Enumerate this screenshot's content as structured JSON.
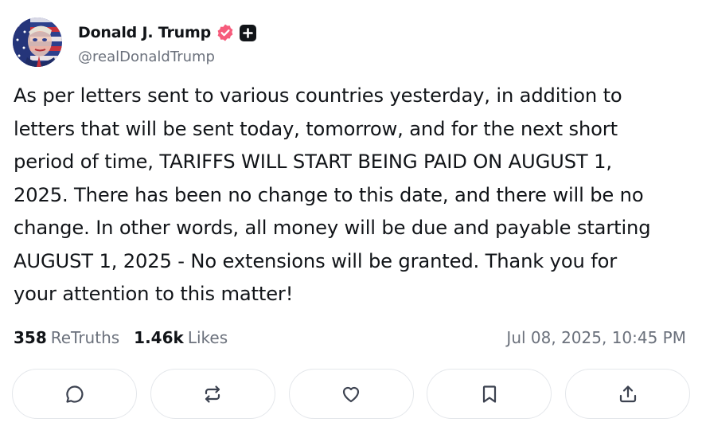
{
  "author": {
    "display_name": "Donald J. Trump",
    "handle": "@realDonaldTrump",
    "avatar_icon": "avatar-flag-portrait",
    "verified_icon": "verified-badge-icon",
    "plus_icon": "plus-badge-icon"
  },
  "post": {
    "text": "As per letters sent to various countries yesterday, in addition to\nletters that will be sent today, tomorrow, and for the next short\nperiod of time, TARIFFS WILL START BEING PAID ON AUGUST 1,\n2025. There has been no change to this date, and there will be no\nchange. In other words, all money will be due and payable starting\nAUGUST 1, 2025 - No extensions will be granted. Thank you for\nyour attention to this matter!",
    "retruths_count": "358",
    "retruths_label": "ReTruths",
    "likes_count": "1.46k",
    "likes_label": "Likes",
    "timestamp": "Jul 08, 2025, 10:45 PM"
  },
  "actions": [
    {
      "name": "reply",
      "icon": "comment-icon"
    },
    {
      "name": "retruth",
      "icon": "repost-icon"
    },
    {
      "name": "like",
      "icon": "heart-icon"
    },
    {
      "name": "bookmark",
      "icon": "bookmark-icon"
    },
    {
      "name": "share",
      "icon": "share-icon"
    }
  ],
  "colors": {
    "verified": "#f65c7c",
    "text": "#111418",
    "muted": "#6b717c",
    "border": "#e4e7eb"
  }
}
